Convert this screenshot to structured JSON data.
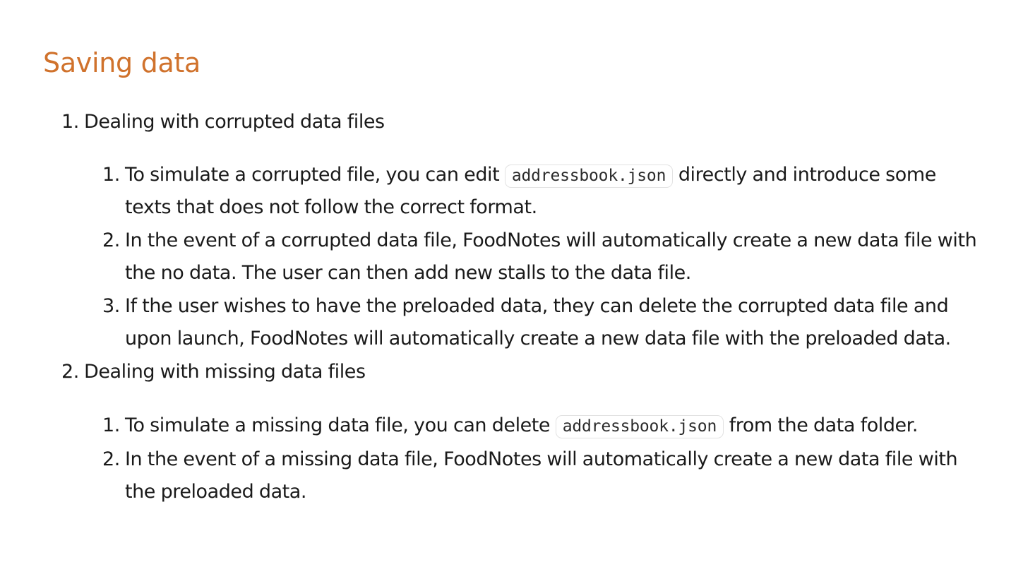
{
  "heading": "Saving data",
  "sections": [
    {
      "number": "1.",
      "title": "Dealing with corrupted data files",
      "items": [
        {
          "number": "1.",
          "text_before": "To simulate a corrupted file, you can edit",
          "code": "addressbook.json",
          "text_after": "directly and introduce some",
          "continuation": "texts that does not follow the correct format."
        },
        {
          "number": "2.",
          "line1": "In the event of a corrupted data file, FoodNotes will automatically create a new data file with",
          "line2": "the no data. The user can then add new stalls to the data file."
        },
        {
          "number": "3.",
          "line1": "If the user wishes to have the preloaded data, they can delete the corrupted data file and",
          "line2": "upon launch, FoodNotes will automatically create a new data file with the preloaded data."
        }
      ]
    },
    {
      "number": "2.",
      "title": "Dealing with missing data files",
      "items": [
        {
          "number": "1.",
          "text_before": "To simulate a missing data file, you can delete",
          "code": "addressbook.json",
          "text_after": "from the data folder."
        },
        {
          "number": "2.",
          "line1": "In the event of a missing data file, FoodNotes will automatically create a new data file with",
          "line2": "the preloaded data."
        }
      ]
    }
  ]
}
